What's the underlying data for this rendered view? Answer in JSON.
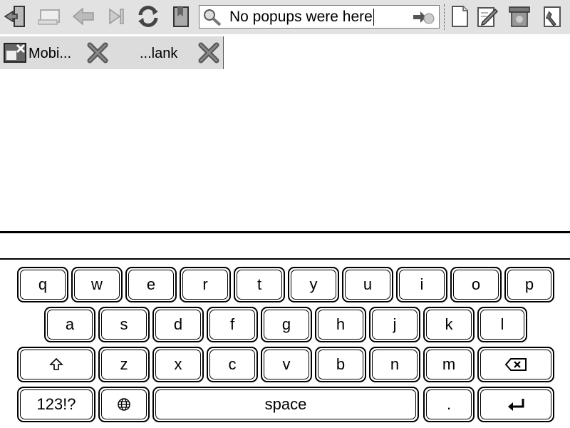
{
  "toolbar": {
    "url_value": "No popups were here",
    "buttons": {
      "exit": "exit-icon",
      "window": "window-icon",
      "back": "back-arrow-icon",
      "skip": "skip-forward-icon",
      "reload": "reload-icon",
      "bookmark": "bookmark-icon",
      "new_page": "new-page-icon",
      "edit": "edit-icon",
      "trash": "trash-icon",
      "settings": "settings-icon"
    }
  },
  "tabs": [
    {
      "label": "Mobi...",
      "icon": "mobile-page-icon"
    },
    {
      "label": "...lank",
      "icon": ""
    }
  ],
  "keyboard": {
    "row1": [
      "q",
      "w",
      "e",
      "r",
      "t",
      "y",
      "u",
      "i",
      "o",
      "p"
    ],
    "row2": [
      "a",
      "s",
      "d",
      "f",
      "g",
      "h",
      "j",
      "k",
      "l"
    ],
    "row3": [
      "z",
      "x",
      "c",
      "v",
      "b",
      "n",
      "m"
    ],
    "numbers_label": "123!?",
    "space_label": "space",
    "period_label": "."
  },
  "colors": {
    "toolbar_bg": "#e2e2e2",
    "tab_bg": "#dcdcdc",
    "key_border": "#000000"
  }
}
